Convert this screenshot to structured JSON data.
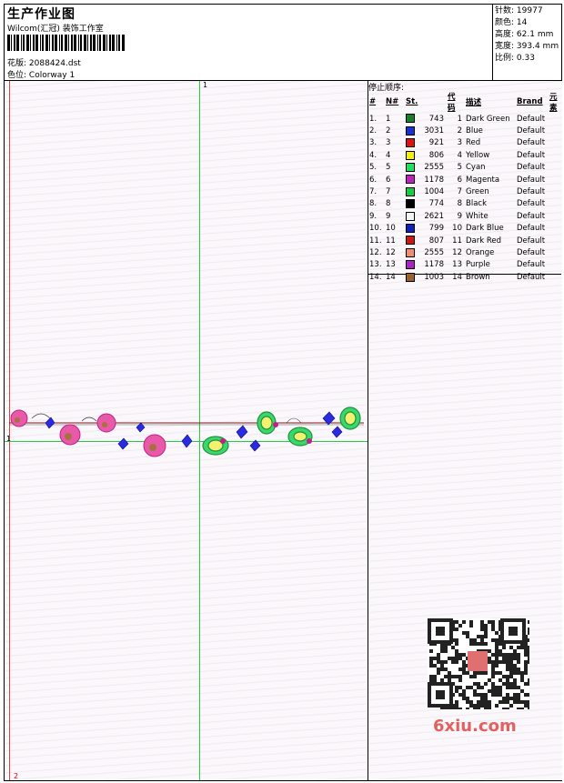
{
  "header": {
    "title": "生产作业图",
    "company": "Wilcom(汇冠) 装饰工作室",
    "design_label": "花版:",
    "design_value": "2088424.dst",
    "colorway_label": "色位:",
    "colorway_value": "Colorway 1"
  },
  "stats": {
    "stitches_label": "针数:",
    "stitches": "19977",
    "colors_label": "颜色:",
    "colors": "14",
    "height_label": "高度:",
    "height": "62.1 mm",
    "width_label": "宽度:",
    "width": "393.4 mm",
    "scale_label": "比例:",
    "scale": "0.33"
  },
  "canvas": {
    "marker_top": "1",
    "marker_left": "1",
    "marker_bottom": "2"
  },
  "stop_sequence": {
    "title": "停止顺序:",
    "columns": [
      "#",
      "N#",
      "St.",
      "代码",
      "描述",
      "Brand",
      "元素"
    ],
    "rows": [
      {
        "idx": "1.",
        "n": "1",
        "color": "#1a7f2a",
        "st": "743",
        "code": "1",
        "desc": "Dark Green",
        "brand": "Default"
      },
      {
        "idx": "2.",
        "n": "2",
        "color": "#1a2fd0",
        "st": "3031",
        "code": "2",
        "desc": "Blue",
        "brand": "Default"
      },
      {
        "idx": "3.",
        "n": "3",
        "color": "#e01010",
        "st": "921",
        "code": "3",
        "desc": "Red",
        "brand": "Default"
      },
      {
        "idx": "4.",
        "n": "4",
        "color": "#f0f000",
        "st": "806",
        "code": "4",
        "desc": "Yellow",
        "brand": "Default"
      },
      {
        "idx": "5.",
        "n": "5",
        "color": "#20e060",
        "st": "2555",
        "code": "5",
        "desc": "Cyan",
        "brand": "Default"
      },
      {
        "idx": "6.",
        "n": "6",
        "color": "#c020c0",
        "st": "1178",
        "code": "6",
        "desc": "Magenta",
        "brand": "Default"
      },
      {
        "idx": "7.",
        "n": "7",
        "color": "#10d040",
        "st": "1004",
        "code": "7",
        "desc": "Green",
        "brand": "Default"
      },
      {
        "idx": "8.",
        "n": "8",
        "color": "#000000",
        "st": "774",
        "code": "8",
        "desc": "Black",
        "brand": "Default"
      },
      {
        "idx": "9.",
        "n": "9",
        "color": "#f4f4f4",
        "st": "2621",
        "code": "9",
        "desc": "White",
        "brand": "Default"
      },
      {
        "idx": "10.",
        "n": "10",
        "color": "#1020c0",
        "st": "799",
        "code": "10",
        "desc": "Dark Blue",
        "brand": "Default"
      },
      {
        "idx": "11.",
        "n": "11",
        "color": "#c81818",
        "st": "807",
        "code": "11",
        "desc": "Dark Red",
        "brand": "Default"
      },
      {
        "idx": "12.",
        "n": "12",
        "color": "#f08c70",
        "st": "2555",
        "code": "12",
        "desc": "Orange",
        "brand": "Default"
      },
      {
        "idx": "13.",
        "n": "13",
        "color": "#b020c8",
        "st": "1178",
        "code": "13",
        "desc": "Purple",
        "brand": "Default"
      },
      {
        "idx": "14.",
        "n": "14",
        "color": "#9a6030",
        "st": "1003",
        "code": "14",
        "desc": "Brown",
        "brand": "Default"
      }
    ]
  },
  "watermark": {
    "site": "6xiu.com"
  }
}
